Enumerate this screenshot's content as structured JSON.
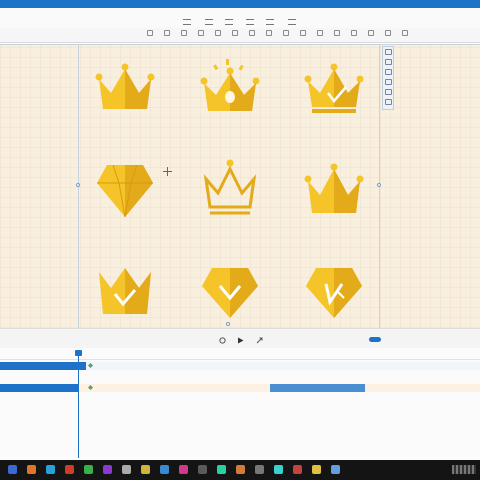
{
  "window": {
    "title": ""
  },
  "colors": {
    "accent": "#1e73c8",
    "gold": "#f5c428",
    "gold_dark": "#d99a12",
    "canvas_bg": "#f9efdf",
    "timeline_bar": "#4a8fd0"
  },
  "menubar": {
    "items": [
      "",
      "",
      "",
      "",
      "",
      ""
    ]
  },
  "toolbar": {
    "tools": [
      "align-left",
      "align-center",
      "align-right",
      "align-top",
      "align-middle",
      "align-bottom",
      "distribute-h",
      "distribute-v",
      "group",
      "ungroup",
      "lock",
      "hide",
      "crop",
      "flip",
      "rotate",
      "more"
    ]
  },
  "side_panel": {
    "tools": [
      "copy-icon",
      "paste-icon",
      "layer-icon",
      "frame-icon",
      "flag-icon",
      "lock-icon"
    ]
  },
  "canvas": {
    "icons": [
      {
        "name": "crown-icon"
      },
      {
        "name": "sparkle-crown-icon"
      },
      {
        "name": "check-crown-icon"
      },
      {
        "name": "diamond-icon"
      },
      {
        "name": "outline-crown-icon"
      },
      {
        "name": "crown-icon-2"
      },
      {
        "name": "check-crown-icon-2"
      },
      {
        "name": "check-diamond-icon"
      },
      {
        "name": "v-diamond-icon"
      }
    ]
  },
  "playback": {
    "left_labels": [
      "",
      "",
      ""
    ],
    "time_text": "",
    "zoom_text": ""
  },
  "timeline": {
    "layer_labels": [
      "",
      ""
    ],
    "bar_label": ""
  },
  "taskbar": {
    "apps": [
      "start",
      "browser",
      "folder",
      "office",
      "chat",
      "media",
      "settings",
      "editor",
      "mail",
      "music",
      "tools",
      "store",
      "camera",
      "terminal",
      "photos",
      "video",
      "paint",
      "notes"
    ]
  }
}
